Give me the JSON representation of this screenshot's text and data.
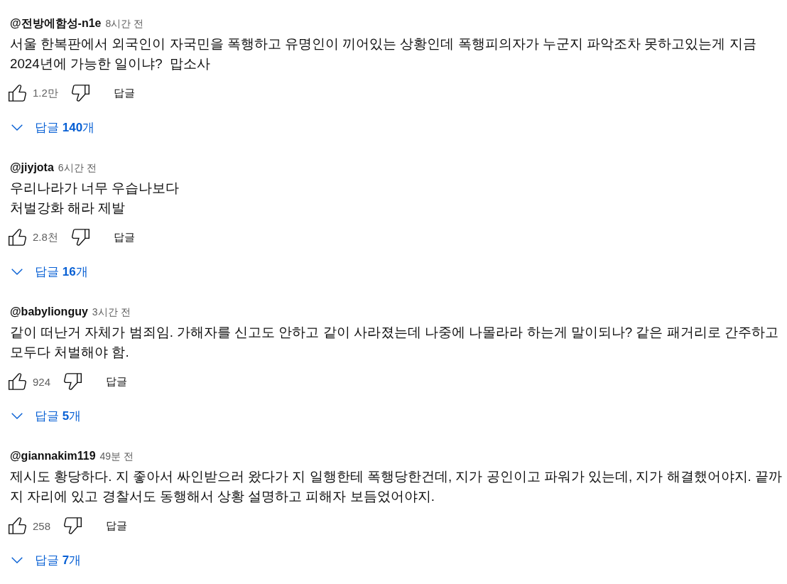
{
  "comments": [
    {
      "author": "@전방에함성-n1e",
      "time": "8시간 전",
      "text": "서울 한복판에서 외국인이 자국민을 폭행하고 유명인이 끼어있는 상황인데 폭행피의자가 누군지 파악조차 못하고있는게 지금 2024년에 가능한 일이냐?  맙소사",
      "likes": "1.2만",
      "reply_label": "답글",
      "replies": "답글 **140**개"
    },
    {
      "author": "@jiyjota",
      "time": "6시간 전",
      "text": "우리나라가 너무 우습나보다\n처벌강화 해라 제발",
      "likes": "2.8천",
      "reply_label": "답글",
      "replies": "답글 **16**개"
    },
    {
      "author": "@babylionguy",
      "time": "3시간 전",
      "text": "같이 떠난거 자체가 범죄임. 가해자를 신고도 안하고 같이 사라졌는데 나중에 나몰라라 하는게 말이되나? 같은 패거리로 간주하고 모두다 처벌해야 함.",
      "likes": "924",
      "reply_label": "답글",
      "replies": "답글 **5**개"
    },
    {
      "author": "@giannakim119",
      "time": "49분 전",
      "text": "제시도 황당하다. 지 좋아서 싸인받으러 왔다가 지 일행한테 폭행당한건데, 지가 공인이고 파워가 있는데, 지가 해결했어야지. 끝까지 자리에 있고 경찰서도 동행해서 상황 설명하고 피해자 보듬었어야지.",
      "likes": "258",
      "reply_label": "답글",
      "replies": "답글 **7**개"
    }
  ]
}
